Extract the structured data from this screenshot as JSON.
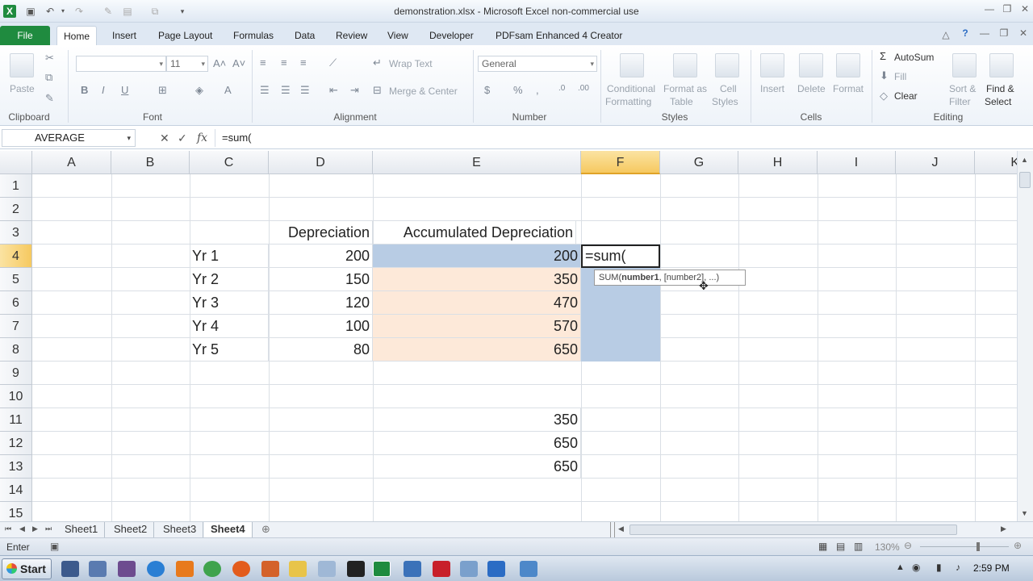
{
  "window": {
    "title": "demonstration.xlsx - Microsoft Excel non-commercial use"
  },
  "ribbon": {
    "tabs": [
      "File",
      "Home",
      "Insert",
      "Page Layout",
      "Formulas",
      "Data",
      "Review",
      "View",
      "Developer",
      "PDFsam Enhanced 4 Creator"
    ],
    "active_tab": "Home",
    "clipboard": {
      "paste": "Paste",
      "label": "Clipboard"
    },
    "font": {
      "size": "11",
      "label": "Font"
    },
    "alignment": {
      "wrap": "Wrap Text",
      "merge": "Merge & Center",
      "label": "Alignment"
    },
    "number": {
      "format": "General",
      "label": "Number"
    },
    "styles": {
      "cond_1": "Conditional",
      "cond_2": "Formatting",
      "table_1": "Format as",
      "table_2": "Table",
      "cell_1": "Cell",
      "cell_2": "Styles",
      "label": "Styles"
    },
    "cells": {
      "insert": "Insert",
      "delete": "Delete",
      "format": "Format",
      "label": "Cells"
    },
    "editing": {
      "autosum": "AutoSum",
      "fill": "Fill",
      "clear": "Clear",
      "sort_1": "Sort &",
      "sort_2": "Filter",
      "find_1": "Find &",
      "find_2": "Select",
      "label": "Editing"
    }
  },
  "formula_bar": {
    "name_box": "AVERAGE",
    "formula": "=sum("
  },
  "grid": {
    "columns": [
      "A",
      "B",
      "C",
      "D",
      "E",
      "F",
      "G",
      "H",
      "I",
      "J",
      "K"
    ],
    "rows": [
      "1",
      "2",
      "3",
      "4",
      "5",
      "6",
      "7",
      "8",
      "9",
      "10",
      "11",
      "12",
      "13",
      "14",
      "15"
    ],
    "cells": {
      "D3": "Depreciation",
      "E3": "Accumulated Depreciation",
      "C4": "Yr 1",
      "D4": "200",
      "E4": "200",
      "F4": "=sum(",
      "C5": "Yr 2",
      "D5": "150",
      "E5": "350",
      "C6": "Yr 3",
      "D6": "120",
      "E6": "470",
      "C7": "Yr 4",
      "D7": "100",
      "E7": "570",
      "C8": "Yr 5",
      "D8": "80",
      "E8": "650",
      "E11": "350",
      "E12": "650",
      "E13": "650"
    },
    "tooltip": {
      "fn": "SUM(",
      "arg1": "number1",
      "rest": ", [number2], ...)"
    }
  },
  "sheets": {
    "tabs": [
      "Sheet1",
      "Sheet2",
      "Sheet3",
      "Sheet4"
    ],
    "active": "Sheet4"
  },
  "status": {
    "mode": "Enter",
    "zoom": "130%"
  },
  "taskbar": {
    "start": "Start",
    "clock": "2:59 PM"
  },
  "colors": {
    "selected_range": "#b8cce4",
    "highlight_range": "#fde9d9",
    "header_selected": "#f6c960",
    "file_tab": "#1f8b3f"
  }
}
